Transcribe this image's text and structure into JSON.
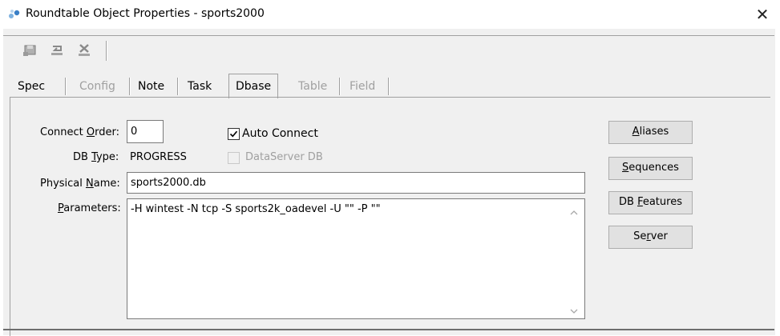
{
  "window": {
    "title": "Roundtable Object Properties - sports2000",
    "close_glyph": "✕"
  },
  "toolbar": {
    "buttons": [
      {
        "name": "save-icon"
      },
      {
        "name": "undo-icon"
      },
      {
        "name": "delete-icon"
      }
    ]
  },
  "tabs": [
    {
      "label": "Spec",
      "enabled": true
    },
    {
      "label": "Config",
      "enabled": false
    },
    {
      "label": "Note",
      "enabled": true
    },
    {
      "label": "Task",
      "enabled": true
    },
    {
      "label": "Dbase",
      "enabled": true,
      "active": true
    },
    {
      "label": "Table",
      "enabled": false
    },
    {
      "label": "Field",
      "enabled": false
    }
  ],
  "form": {
    "connect_order_label_pre": "Connect ",
    "connect_order_label_u": "O",
    "connect_order_label_post": "rder:",
    "connect_order_value": "0",
    "auto_connect_label": "Auto Connect",
    "auto_connect_checked": true,
    "db_type_label_pre": "DB ",
    "db_type_label_u": "T",
    "db_type_label_post": "ype:",
    "db_type_value": "PROGRESS",
    "dataserver_label": "DataServer DB",
    "dataserver_checked": false,
    "physical_name_label_pre": "Physical ",
    "physical_name_label_u": "N",
    "physical_name_label_post": "ame:",
    "physical_name_value": "sports2000.db",
    "parameters_label_u": "P",
    "parameters_label_post": "arameters:",
    "parameters_value": "-H wintest -N tcp -S sports2k_oadevel -U \"\" -P \"\""
  },
  "buttons": {
    "aliases_u": "A",
    "aliases_post": "liases",
    "sequences_u": "S",
    "sequences_post": "equences",
    "db_features_pre": "DB ",
    "db_features_u": "F",
    "db_features_post": "eatures",
    "server_pre": "Se",
    "server_u": "r",
    "server_post": "ver"
  }
}
